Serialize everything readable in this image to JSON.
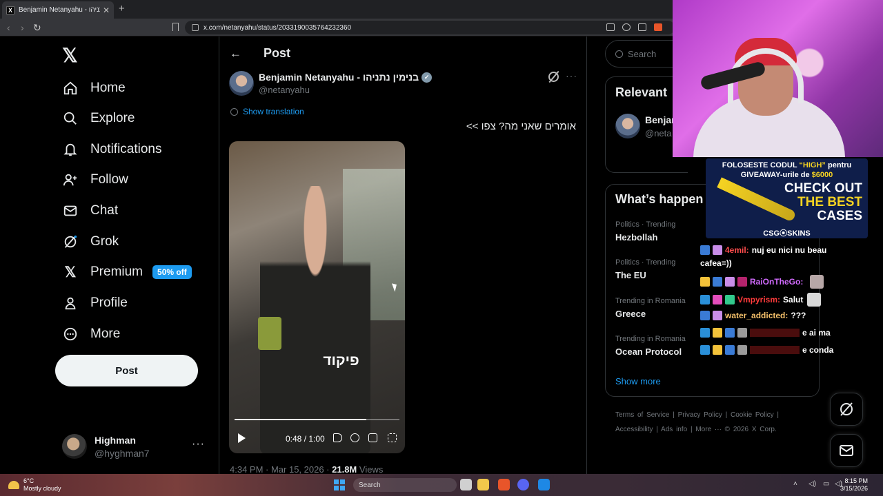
{
  "browser": {
    "tab_title": "Benjamin Netanyahu - בנימין נתניהו",
    "url": "x.com/netanyahu/status/2033190035764232360"
  },
  "nav": {
    "items": [
      {
        "label": "Home",
        "icon": "home-icon"
      },
      {
        "label": "Explore",
        "icon": "search-icon"
      },
      {
        "label": "Notifications",
        "icon": "bell-icon"
      },
      {
        "label": "Follow",
        "icon": "add-user-icon"
      },
      {
        "label": "Chat",
        "icon": "mail-icon"
      },
      {
        "label": "Grok",
        "icon": "grok-icon"
      },
      {
        "label": "Premium",
        "icon": "x-logo-icon"
      },
      {
        "label": "Profile",
        "icon": "person-icon"
      },
      {
        "label": "More",
        "icon": "more-circle-icon"
      }
    ],
    "premium_badge": "50% off",
    "post_button": "Post",
    "account": {
      "name": "Highman",
      "handle": "@hyghman7"
    }
  },
  "post": {
    "header_title": "Post",
    "author_name": "Benjamin Netanyahu - בנימין נתניהו",
    "author_handle": "@netanyahu",
    "show_translation": "Show translation",
    "text": "אומרים שאני מה? צפו >>",
    "video": {
      "caption": "פיקוד",
      "time": "0:48 / 1:00",
      "progress": 0.8
    },
    "time": "4:34 PM · Mar 15, 2026 · ",
    "views_count": "21.8M",
    "views_label": " Views"
  },
  "sidebar": {
    "search_placeholder": "Search",
    "relevant_title": "Relevant",
    "relevant_name": "Benjam",
    "relevant_handle": "@neta",
    "happening_title": "What’s happen",
    "trends": [
      {
        "context": "Politics · Trending",
        "name": "Hezbollah"
      },
      {
        "context": "Politics · Trending",
        "name": "The EU"
      },
      {
        "context": "Trending in Romania",
        "name": "Greece"
      },
      {
        "context": "Trending in Romania",
        "name": "Ocean Protocol"
      }
    ],
    "show_more": "Show more",
    "footer_line1": "Terms of Service  |  Privacy Policy  |  Cookie Policy  |",
    "footer_line2": "Accessibility  |  Ads info  |  More ···  © 2026 X Corp."
  },
  "ad": {
    "line1_a": "FOLOSESTE CODUL ",
    "line1_code": "“HIGH”",
    "line1_b": " pentru",
    "line2_a": "GIVEAWAY-urile de ",
    "line2_amount": "$6000",
    "big1": "CHECK OUT",
    "big2": "THE BEST",
    "big3": "CASES",
    "brand": "CSG⦿SKINS"
  },
  "chat": [
    {
      "user": "4emil:",
      "user_color": "#ff4d4d",
      "msg": " nuj eu nici nu beau",
      "msg2": "cafea=))"
    },
    {
      "user": "RaiOnTheGo:",
      "user_color": "#d26bff",
      "msg": ""
    },
    {
      "user": "Vmpyrism:",
      "user_color": "#ff3b3b",
      "msg": " Salut"
    },
    {
      "user": "water_addicted:",
      "user_color": "#f5c06a",
      "msg": " ???"
    },
    {
      "user": "",
      "user_color": "#fff",
      "msg": "e ai ma"
    },
    {
      "user": "",
      "user_color": "#fff",
      "msg": "e conda"
    }
  ],
  "taskbar": {
    "temp": "6°C",
    "weather": "Mostly cloudy",
    "search": "Search",
    "time": "8:15 PM",
    "date": "3/15/2026"
  }
}
